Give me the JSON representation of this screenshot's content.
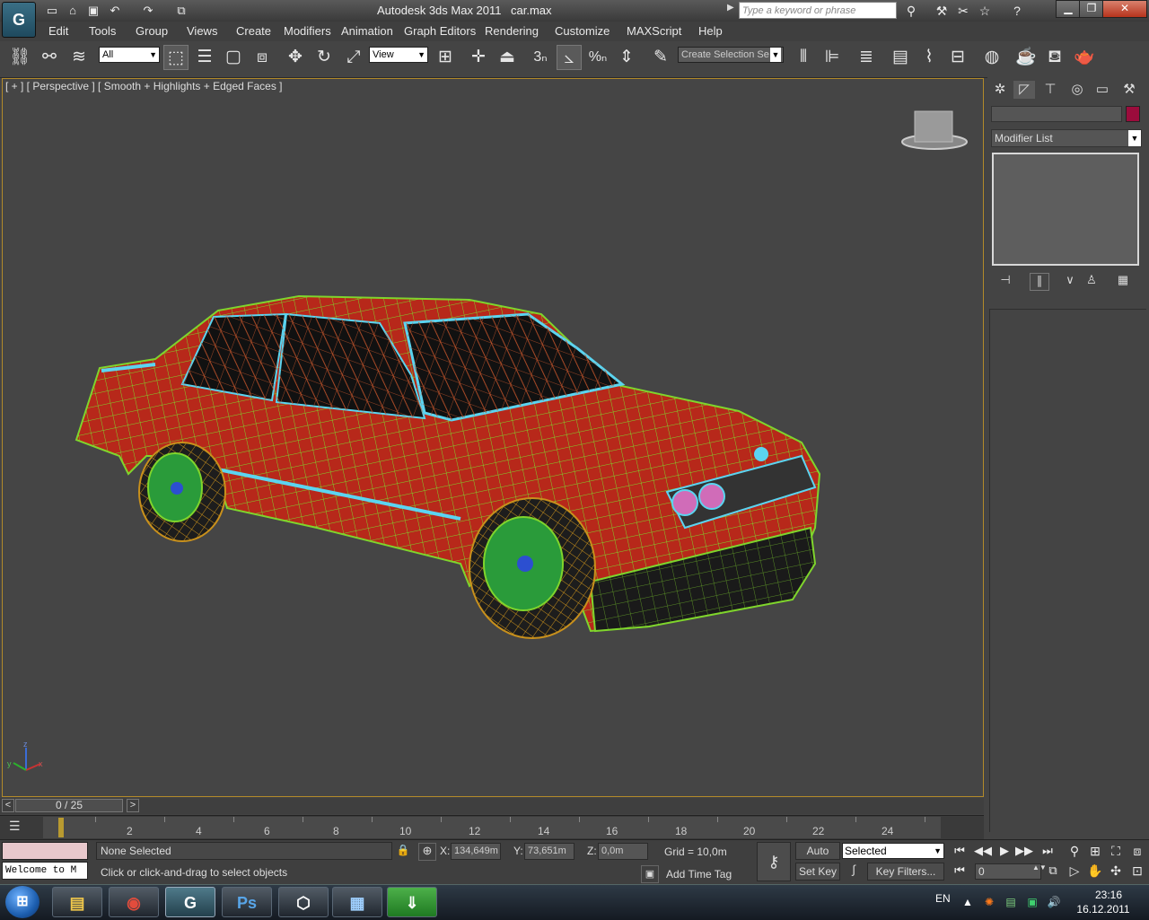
{
  "titlebar": {
    "app_title": "Autodesk 3ds Max  2011",
    "file_name": "car.max",
    "search_placeholder": "Type a keyword or phrase",
    "logo_glyph": "G"
  },
  "menu": [
    "Edit",
    "Tools",
    "Group",
    "Views",
    "Create",
    "Modifiers",
    "Animation",
    "Graph Editors",
    "Rendering",
    "Customize",
    "MAXScript",
    "Help"
  ],
  "toolbar": {
    "selection_filter": "All",
    "ref_coord": "View",
    "named_selection": "Create Selection Se",
    "snap_value": "3",
    "percent_snap": "%"
  },
  "viewport": {
    "label": "[ + ] [ Perspective ] [ Smooth + Highlights + Edged Faces ]",
    "axis_x": "x",
    "axis_y": "y",
    "axis_z": "z",
    "bg_color": "#454545",
    "wire_color": "#7fd52c",
    "body_color": "#b7281a"
  },
  "command_panel": {
    "modifier_list": "Modifier List",
    "object_color": "#9b0c3c"
  },
  "timeline": {
    "frame_display": "0 / 25",
    "ticks": [
      "2",
      "4",
      "6",
      "8",
      "10",
      "12",
      "14",
      "16",
      "18",
      "20",
      "22",
      "24"
    ]
  },
  "status": {
    "selection": "None Selected",
    "prompt": "Click or click-and-drag to select objects",
    "maxscript_output": "Welcome to M",
    "x_label": "X:",
    "x_value": "134,649m",
    "y_label": "Y:",
    "y_value": "73,651m",
    "z_label": "Z:",
    "z_value": "0,0m",
    "grid": "Grid = 10,0m",
    "add_time_tag": "Add Time Tag",
    "auto_key": "Auto Key",
    "set_key": "Set Key",
    "key_mode": "Selected",
    "key_filters": "Key Filters...",
    "current_frame": "0"
  },
  "taskbar": {
    "lang": "EN",
    "time": "23:16",
    "date": "16.12.2011",
    "apps": [
      "file-explorer",
      "chrome",
      "3ds-max",
      "photoshop",
      "unity",
      "remote-desktop",
      "download-manager"
    ],
    "ps_label": "Ps"
  }
}
